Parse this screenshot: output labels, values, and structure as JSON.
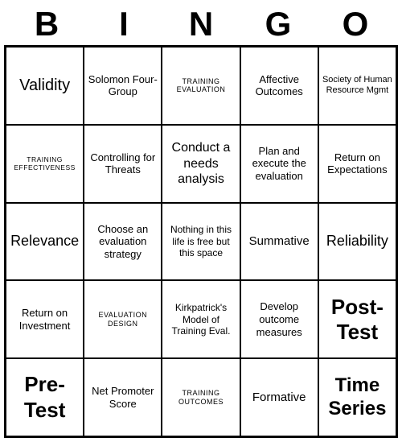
{
  "title": {
    "letters": [
      "B",
      "I",
      "N",
      "G",
      "O"
    ]
  },
  "cells": [
    {
      "text": "Validity",
      "size": "medium"
    },
    {
      "text": "Solomon Four-Group",
      "size": "normal"
    },
    {
      "text": "TRAINING EVALUATION",
      "size": "small"
    },
    {
      "text": "Affective Outcomes",
      "size": "normal"
    },
    {
      "text": "Society of Human Resource Mgmt",
      "size": "small-normal"
    },
    {
      "text": "TRAINING EFFECTIVENESS",
      "size": "small"
    },
    {
      "text": "Controlling for Threats",
      "size": "normal"
    },
    {
      "text": "Conduct a needs analysis",
      "size": "large-normal"
    },
    {
      "text": "Plan and execute the evaluation",
      "size": "normal"
    },
    {
      "text": "Return on Expectations",
      "size": "normal"
    },
    {
      "text": "Relevance",
      "size": "medium"
    },
    {
      "text": "Choose an evaluation strategy",
      "size": "normal"
    },
    {
      "text": "Nothing in this life is free but this space",
      "size": "normal"
    },
    {
      "text": "Summative",
      "size": "normal"
    },
    {
      "text": "Reliability",
      "size": "medium"
    },
    {
      "text": "Return on Investment",
      "size": "normal"
    },
    {
      "text": "EVALUATION DESIGN",
      "size": "small"
    },
    {
      "text": "Kirkpatrick's Model of Training Eval.",
      "size": "normal"
    },
    {
      "text": "Develop outcome measures",
      "size": "normal"
    },
    {
      "text": "Post-Test",
      "size": "large"
    },
    {
      "text": "Pre-Test",
      "size": "large"
    },
    {
      "text": "Net Promoter Score",
      "size": "normal"
    },
    {
      "text": "TRAINING OUTCOMES",
      "size": "small"
    },
    {
      "text": "Formative",
      "size": "normal"
    },
    {
      "text": "Time Series",
      "size": "large"
    }
  ]
}
